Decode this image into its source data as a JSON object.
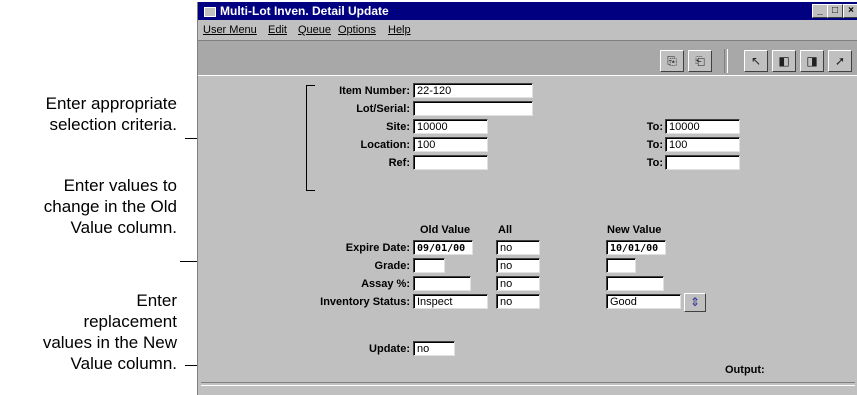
{
  "callouts": {
    "selection": [
      "Enter appropriate",
      "selection criteria."
    ],
    "old_values": [
      "Enter values to",
      "change in the Old",
      "Value column."
    ],
    "new_values": [
      "Enter",
      "replacement",
      "values in the New",
      "Value column."
    ]
  },
  "window": {
    "title": "Multi-Lot Inven. Detail Update",
    "minimize": "_",
    "maximize": "□",
    "close": "×"
  },
  "menu": [
    "User Menu",
    "Edit",
    "Queue",
    "Options",
    "Help"
  ],
  "toolbar_icons": [
    "copy-icon",
    "paste-icon",
    "help-pointer-icon",
    "previous-record-icon",
    "next-record-icon",
    "exit-icon"
  ],
  "selection": {
    "item_number": {
      "label": "Item Number:",
      "value": "22-120"
    },
    "lot_serial": {
      "label": "Lot/Serial:",
      "value": ""
    },
    "site": {
      "label": "Site:",
      "value": "10000",
      "to_label": "To:",
      "to_value": "10000"
    },
    "location": {
      "label": "Location:",
      "value": "100",
      "to_label": "To:",
      "to_value": "100"
    },
    "ref": {
      "label": "Ref:",
      "value": "",
      "to_label": "To:",
      "to_value": ""
    }
  },
  "headers": {
    "old_value": "Old Value",
    "all": "All",
    "new_value": "New Value"
  },
  "rows": {
    "expire_date": {
      "label": "Expire Date:",
      "old": "09/01/00",
      "all": "no",
      "new": "10/01/00"
    },
    "grade": {
      "label": "Grade:",
      "old": "",
      "all": "no",
      "new": ""
    },
    "assay": {
      "label": "Assay %:",
      "old": "",
      "all": "no",
      "new": ""
    },
    "inventory_status": {
      "label": "Inventory Status:",
      "old": "Inspect",
      "all": "no",
      "new": "Good"
    }
  },
  "update": {
    "label": "Update:",
    "value": "no"
  },
  "output": {
    "label": "Output:"
  }
}
